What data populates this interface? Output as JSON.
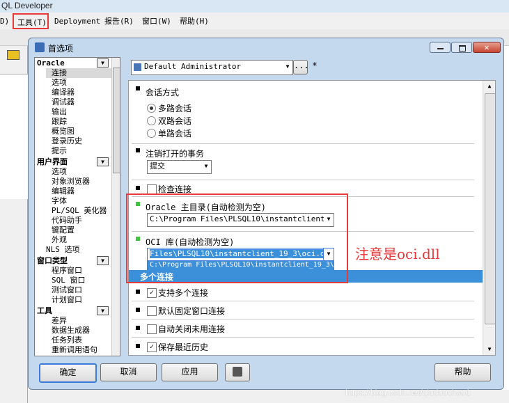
{
  "app": {
    "title": "QL Developer"
  },
  "menu": {
    "d": "D)",
    "tools": "工具(T)",
    "deployment": "Deployment",
    "report": "报告(R)",
    "window": "窗口(W)",
    "help": "帮助(H)"
  },
  "dialog": {
    "title": "首选项"
  },
  "tree": {
    "oracle": {
      "header": "Oracle",
      "items": [
        "连接",
        "选项",
        "编译器",
        "调试器",
        "输出",
        "跟踪",
        "概览图",
        "登录历史",
        "提示"
      ]
    },
    "ui": {
      "header": "用户界面",
      "items": [
        "选项",
        "对象浏览器",
        "编辑器",
        "字体",
        "PL/SQL 美化器",
        "代码助手",
        "键配置",
        "外观"
      ],
      "nls": "NLS 选项"
    },
    "wintype": {
      "header": "窗口类型",
      "items": [
        "程序窗口",
        "SQL 窗口",
        "测试窗口",
        "计划窗口"
      ]
    },
    "tools": {
      "header": "工具",
      "items": [
        "差异",
        "数据生成器",
        "任务列表",
        "重新调用语句"
      ]
    }
  },
  "profile": {
    "value": "Default Administrator",
    "more": "...",
    "modified": "*"
  },
  "sections": {
    "session_mode": {
      "title": "会话方式",
      "options": [
        "多路会话",
        "双路会话",
        "单路会话"
      ],
      "selected": 0
    },
    "commit": {
      "title": "注销打开的事务",
      "value": "提交"
    },
    "check": {
      "label": "检查连接"
    },
    "oracle_home": {
      "title": "Oracle 主目录(自动检测为空)",
      "value": "C:\\Program Files\\PLSQL10\\instantclient_19_3"
    },
    "oci": {
      "title": "OCI 库(自动检测为空)",
      "value": "Files\\PLSQL10\\instantclient_19_3\\oci.dll",
      "dropdown_option": "C:\\Program Files\\PLSQL10\\instantclient_19_3\\"
    },
    "multi": {
      "title": "多个连接",
      "items": [
        {
          "label": "支持多个连接",
          "checked": true
        },
        {
          "label": "默认固定窗口连接",
          "checked": false
        },
        {
          "label": "自动关闭未用连接",
          "checked": false
        },
        {
          "label": "保存最近历史",
          "checked": true
        }
      ]
    }
  },
  "annotation": "注意是oci.dll",
  "buttons": {
    "ok": "确定",
    "cancel": "取消",
    "apply": "应用",
    "help": "帮助"
  },
  "watermark": "https://blog.csdn.net/qiuduochao1",
  "colors": {
    "accent": "#e8393b",
    "selection": "#3c8fd9",
    "section_active": "#3ec43e"
  }
}
